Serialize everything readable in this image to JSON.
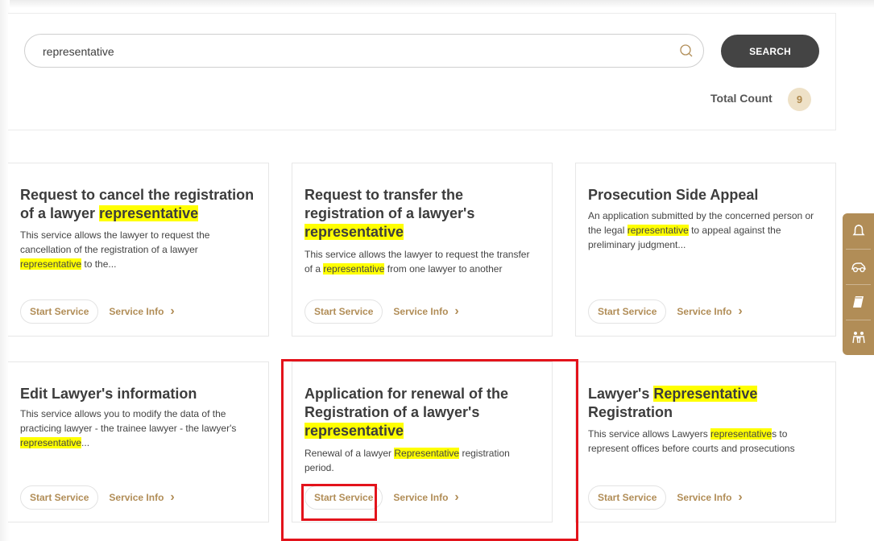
{
  "search": {
    "value": "representative",
    "button_label": "SEARCH",
    "total_label": "Total Count",
    "total_value": "9"
  },
  "cards": [
    {
      "title_parts": [
        "Request to cancel the registration of a lawyer ",
        "representative"
      ],
      "desc_parts": [
        "This service allows the lawyer to request the cancellation of the registration of a lawyer ",
        "representative",
        " to the..."
      ],
      "start_label": "Start Service",
      "info_label": "Service Info"
    },
    {
      "title_parts": [
        "Request to transfer the registration of a lawyer's ",
        "representative"
      ],
      "desc_parts": [
        "This service allows the lawyer to request the transfer of a ",
        "representative",
        " from one lawyer to another"
      ],
      "start_label": "Start Service",
      "info_label": "Service Info"
    },
    {
      "title_parts": [
        "Prosecution Side Appeal"
      ],
      "desc_parts": [
        "An application submitted by the concerned person or the legal ",
        "representative",
        " to appeal against the preliminary judgment..."
      ],
      "start_label": "Start Service",
      "info_label": "Service Info"
    },
    {
      "title_parts": [
        "Edit Lawyer's information"
      ],
      "desc_parts": [
        "This service allows you to modify the data of the practicing lawyer - the trainee lawyer - the lawyer's ",
        "representative",
        "..."
      ],
      "start_label": "Start Service",
      "info_label": "Service Info"
    },
    {
      "title_parts": [
        "Application for renewal of the Registration of a lawyer's ",
        "representative"
      ],
      "desc_parts": [
        "Renewal of a lawyer ",
        "Representative",
        " registration period."
      ],
      "start_label": "Start Service",
      "info_label": "Service Info"
    },
    {
      "title_parts": [
        "Lawyer's ",
        "Representative",
        " Registration"
      ],
      "desc_parts": [
        "This service allows Lawyers ",
        "representative",
        "s to represent offices before courts and prosecutions"
      ],
      "start_label": "Start Service",
      "info_label": "Service Info"
    }
  ],
  "side_rail": {
    "icons": [
      "bell-icon",
      "car-icon",
      "book-icon",
      "family-icon"
    ]
  },
  "colors": {
    "accent": "#b18d57",
    "highlight": "#ffff00",
    "annotation": "#e3131b",
    "search_button": "#444444"
  }
}
